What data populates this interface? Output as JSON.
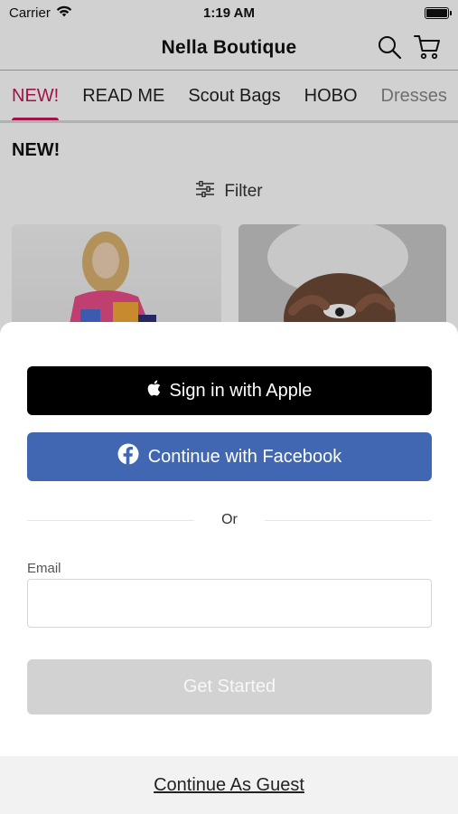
{
  "status_bar": {
    "carrier": "Carrier",
    "time": "1:19 AM"
  },
  "header": {
    "title": "Nella Boutique",
    "icons": [
      "search-icon",
      "cart-icon"
    ]
  },
  "tabs": [
    {
      "label": "NEW!",
      "active": true
    },
    {
      "label": "READ ME"
    },
    {
      "label": "Scout Bags"
    },
    {
      "label": "HOBO"
    },
    {
      "label": "Dresses"
    }
  ],
  "content": {
    "section_title": "NEW!",
    "filter_label": "Filter"
  },
  "sheet": {
    "apple_button": "Sign in with Apple",
    "facebook_button": "Continue with Facebook",
    "or_text": "Or",
    "email_label": "Email",
    "email_value": "",
    "get_started_button": "Get Started",
    "guest_link": "Continue As Guest"
  },
  "colors": {
    "accent": "#c2185b",
    "facebook": "#4267b2",
    "apple": "#000000",
    "disabled": "#d2d2d2"
  }
}
